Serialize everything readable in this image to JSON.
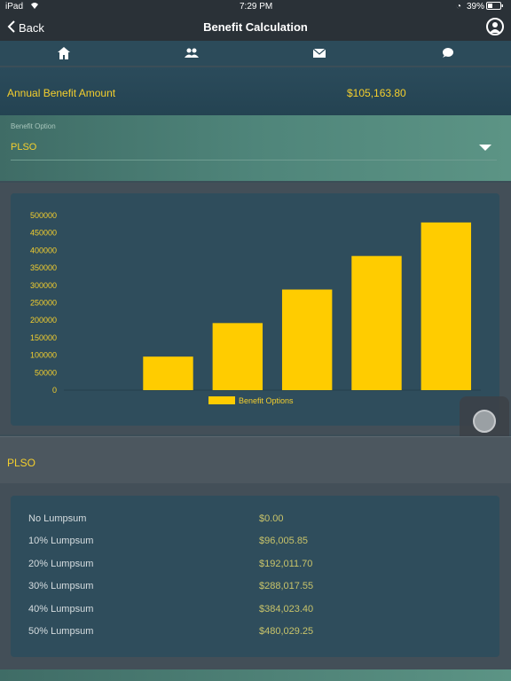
{
  "status_bar": {
    "device": "iPad",
    "time": "7:29 PM",
    "battery": "39%"
  },
  "nav": {
    "back_label": "Back",
    "title": "Benefit Calculation"
  },
  "tabs": [
    {
      "icon": "home-icon"
    },
    {
      "icon": "people-icon"
    },
    {
      "icon": "mail-icon"
    },
    {
      "icon": "chat-icon"
    }
  ],
  "annual": {
    "label": "Annual Benefit Amount",
    "value": "$105,163.80"
  },
  "benefit_option": {
    "hint": "Benefit Option",
    "selected": "PLSO"
  },
  "chart_data": {
    "type": "bar",
    "categories": [
      "No Lumpsum",
      "10% Lumpsum",
      "20% Lumpsum",
      "30% Lumpsum",
      "40% Lumpsum",
      "50% Lumpsum"
    ],
    "series": [
      {
        "name": "Benefit Options",
        "values": [
          0,
          96005.85,
          192011.7,
          288017.55,
          384023.4,
          480029.25
        ],
        "color": "#ffcc00"
      }
    ],
    "yticks": [
      0,
      50000,
      100000,
      150000,
      200000,
      250000,
      300000,
      350000,
      400000,
      450000,
      500000
    ],
    "ylim": [
      0,
      500000
    ],
    "legend": "bottom-center"
  },
  "section_title": "PLSO",
  "rows": [
    {
      "label": "No Lumpsum",
      "value": "$0.00"
    },
    {
      "label": "10% Lumpsum",
      "value": "$96,005.85"
    },
    {
      "label": "20% Lumpsum",
      "value": "$192,011.70"
    },
    {
      "label": "30% Lumpsum",
      "value": "$288,017.55"
    },
    {
      "label": "40% Lumpsum",
      "value": "$384,023.40"
    },
    {
      "label": "50% Lumpsum",
      "value": "$480,029.25"
    }
  ],
  "colors": {
    "accent": "#f4cf2d",
    "bar": "#ffcc00",
    "card": "#2f4d5c"
  }
}
